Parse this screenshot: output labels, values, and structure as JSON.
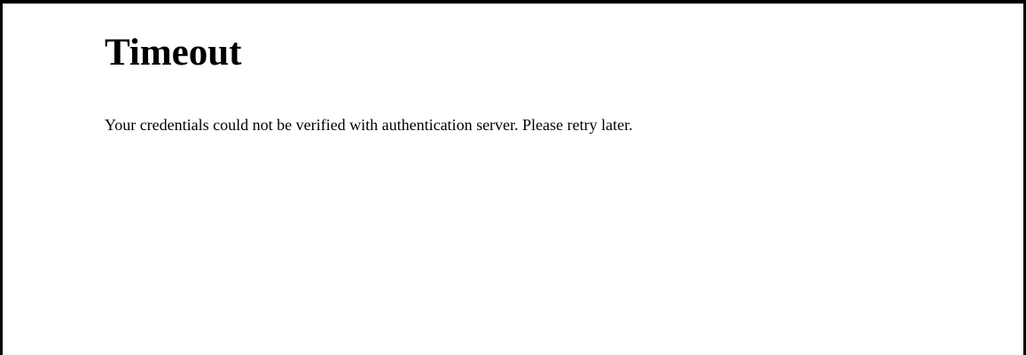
{
  "page": {
    "title": "Timeout",
    "message": "Your credentials could not be verified with authentication server. Please retry later."
  },
  "colors": {
    "background": "#ffffff",
    "text": "#000000",
    "border": "#000000"
  }
}
